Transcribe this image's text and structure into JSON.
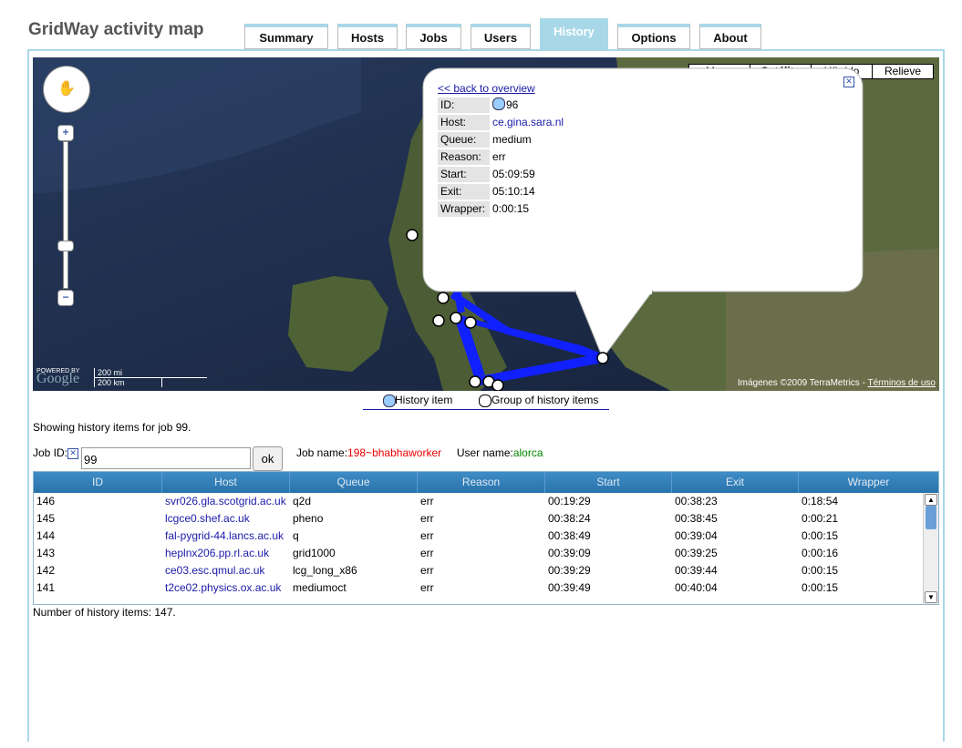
{
  "app": {
    "title": "GridWay activity map"
  },
  "tabs": [
    {
      "label": "Summary"
    },
    {
      "label": "Hosts"
    },
    {
      "label": "Jobs"
    },
    {
      "label": "Users"
    },
    {
      "label": "History"
    },
    {
      "label": "Options"
    },
    {
      "label": "About"
    }
  ],
  "active_tab": "History",
  "map": {
    "types": [
      "Mapa",
      "Satélite",
      "Híbrido",
      "Relieve"
    ],
    "selected_type": "Satélite",
    "scale_mi": "200 mi",
    "scale_km": "200 km",
    "copyright_text": "Imágenes ©2009 TerraMetrics - ",
    "terms_link": "Términos de uso",
    "powered_by": "POWERED BY",
    "google": "Google"
  },
  "infowindow": {
    "back_link": "<< back to overview",
    "rows": [
      {
        "key": "ID:",
        "value": "96"
      },
      {
        "key": "Host:",
        "value": "ce.gina.sara.nl"
      },
      {
        "key": "Queue:",
        "value": "medium"
      },
      {
        "key": "Reason:",
        "value": "err"
      },
      {
        "key": "Start:",
        "value": "05:09:59"
      },
      {
        "key": "Exit:",
        "value": "05:10:14"
      },
      {
        "key": "Wrapper:",
        "value": "0:00:15"
      }
    ]
  },
  "legend": {
    "item": "History item",
    "group": "Group of history items"
  },
  "status": "Showing history items for job 99.",
  "form": {
    "jobid_label": "Job ID:",
    "jobid_value": "99",
    "ok_label": "ok",
    "jobname_label": "Job name:",
    "jobname_value": "198~bhabhaworker",
    "username_label": "User name:",
    "username_value": "alorca"
  },
  "table": {
    "columns": [
      "ID",
      "Host",
      "Queue",
      "Reason",
      "Start",
      "Exit",
      "Wrapper"
    ],
    "rows": [
      {
        "id": "146",
        "host": "svr026.gla.scotgrid.ac.uk",
        "queue": "q2d",
        "reason": "err",
        "start": "00:19:29",
        "exit": "00:38:23",
        "wrapper": "0:18:54"
      },
      {
        "id": "145",
        "host": "lcgce0.shef.ac.uk",
        "queue": "pheno",
        "reason": "err",
        "start": "00:38:24",
        "exit": "00:38:45",
        "wrapper": "0:00:21"
      },
      {
        "id": "144",
        "host": "fal-pygrid-44.lancs.ac.uk",
        "queue": "q",
        "reason": "err",
        "start": "00:38:49",
        "exit": "00:39:04",
        "wrapper": "0:00:15"
      },
      {
        "id": "143",
        "host": "heplnx206.pp.rl.ac.uk",
        "queue": "grid1000",
        "reason": "err",
        "start": "00:39:09",
        "exit": "00:39:25",
        "wrapper": "0:00:16"
      },
      {
        "id": "142",
        "host": "ce03.esc.qmul.ac.uk",
        "queue": "lcg_long_x86",
        "reason": "err",
        "start": "00:39:29",
        "exit": "00:39:44",
        "wrapper": "0:00:15"
      },
      {
        "id": "141",
        "host": "t2ce02.physics.ox.ac.uk",
        "queue": "mediumoct",
        "reason": "err",
        "start": "00:39:49",
        "exit": "00:40:04",
        "wrapper": "0:00:15"
      }
    ]
  },
  "footer": {
    "count_text": "Number of history items: 147."
  }
}
